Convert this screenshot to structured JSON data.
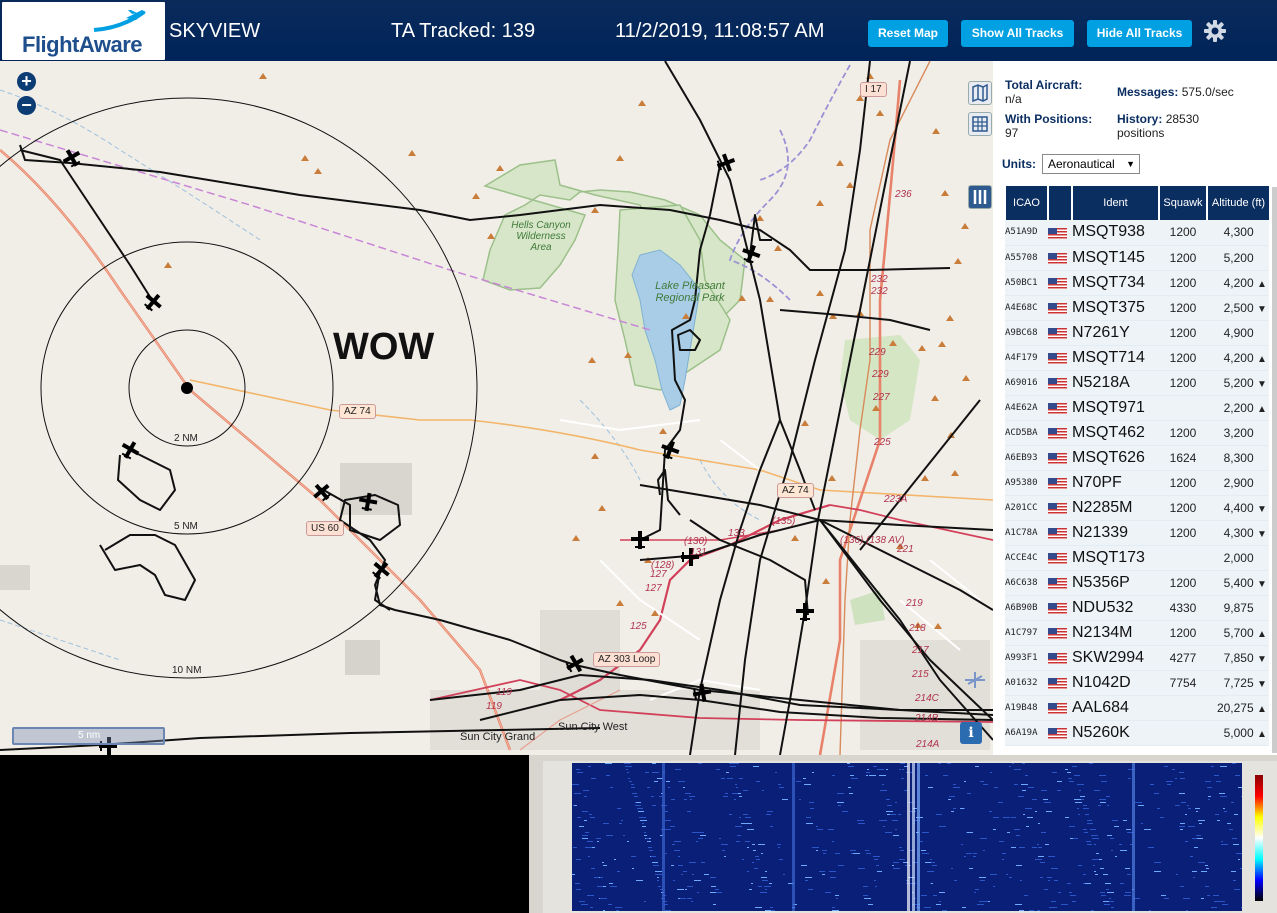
{
  "header": {
    "logo_text": "FlightAware",
    "site_name": "SKYVIEW",
    "tracked_label": "TA Tracked: 139",
    "datetime": "11/2/2019, 11:08:57 AM",
    "buttons": {
      "reset": "Reset Map",
      "show_all": "Show All Tracks",
      "hide_all": "Hide All Tracks"
    },
    "settings_icon": "gear-icon",
    "bg_color": "#002459",
    "button_color": "#00a0e2"
  },
  "map": {
    "zoom_in": "+",
    "zoom_out": "−",
    "overlay_text": "WOW",
    "range_labels": [
      "2 NM",
      "5 NM",
      "10 NM"
    ],
    "scale_label": "5 nm",
    "place_labels": [
      "Hells Canyon Wilderness Area",
      "Lake Pleasant Regional Park",
      "Sun City Grand",
      "Sun City West"
    ],
    "road_shields": [
      "AZ 74",
      "US 60",
      "AZ 303 Loop",
      "AZ 74",
      "I 17"
    ],
    "mile_markers": [
      "236",
      "232",
      "232",
      "229",
      "229",
      "227",
      "225",
      "223A",
      "221",
      "219",
      "218",
      "217",
      "215",
      "214C",
      "214B",
      "214A",
      "125",
      "127",
      "127",
      "119",
      "119",
      "(128)",
      "(130)",
      "(135)",
      "(136)",
      "(138 AV)",
      "133",
      "131"
    ],
    "info_icon": "i",
    "control_icons": [
      "map-icon",
      "grid-icon",
      "columns-icon"
    ]
  },
  "stats": {
    "total_aircraft_label": "Total Aircraft:",
    "total_aircraft_value": "n/a",
    "with_positions_label": "With Positions:",
    "with_positions_value": "97",
    "messages_label": "Messages:",
    "messages_value": "575.0/sec",
    "history_label": "History:",
    "history_value": "28530",
    "history_unit": "positions",
    "units_label": "Units:",
    "units_value": "Aeronautical"
  },
  "table": {
    "headers": [
      "ICAO",
      "",
      "Ident",
      "Squawk",
      "Altitude (ft)"
    ],
    "rows": [
      {
        "icao": "A51A9D",
        "ident": "MSQT938",
        "squawk": "1200",
        "alt": "4,300",
        "trend": ""
      },
      {
        "icao": "A55708",
        "ident": "MSQT145",
        "squawk": "1200",
        "alt": "5,200",
        "trend": ""
      },
      {
        "icao": "A50BC1",
        "ident": "MSQT734",
        "squawk": "1200",
        "alt": "4,200",
        "trend": "▲"
      },
      {
        "icao": "A4E68C",
        "ident": "MSQT375",
        "squawk": "1200",
        "alt": "2,500",
        "trend": "▼"
      },
      {
        "icao": "A9BC68",
        "ident": "N7261Y",
        "squawk": "1200",
        "alt": "4,900",
        "trend": ""
      },
      {
        "icao": "A4F179",
        "ident": "MSQT714",
        "squawk": "1200",
        "alt": "4,200",
        "trend": "▲"
      },
      {
        "icao": "A69016",
        "ident": "N5218A",
        "squawk": "1200",
        "alt": "5,200",
        "trend": "▼"
      },
      {
        "icao": "A4E62A",
        "ident": "MSQT971",
        "squawk": "",
        "alt": "2,200",
        "trend": "▲"
      },
      {
        "icao": "ACD5BA",
        "ident": "MSQT462",
        "squawk": "1200",
        "alt": "3,200",
        "trend": ""
      },
      {
        "icao": "A6EB93",
        "ident": "MSQT626",
        "squawk": "1624",
        "alt": "8,300",
        "trend": ""
      },
      {
        "icao": "A95380",
        "ident": "N70PF",
        "squawk": "1200",
        "alt": "2,900",
        "trend": ""
      },
      {
        "icao": "A201CC",
        "ident": "N2285M",
        "squawk": "1200",
        "alt": "4,400",
        "trend": "▼"
      },
      {
        "icao": "A1C78A",
        "ident": "N21339",
        "squawk": "1200",
        "alt": "4,300",
        "trend": "▼"
      },
      {
        "icao": "ACCE4C",
        "ident": "MSQT173",
        "squawk": "",
        "alt": "2,000",
        "trend": ""
      },
      {
        "icao": "A6C638",
        "ident": "N5356P",
        "squawk": "1200",
        "alt": "5,400",
        "trend": "▼"
      },
      {
        "icao": "A6B90B",
        "ident": "NDU532",
        "squawk": "4330",
        "alt": "9,875",
        "trend": ""
      },
      {
        "icao": "A1C797",
        "ident": "N2134M",
        "squawk": "1200",
        "alt": "5,700",
        "trend": "▲"
      },
      {
        "icao": "A993F1",
        "ident": "SKW2994",
        "squawk": "4277",
        "alt": "7,850",
        "trend": "▼"
      },
      {
        "icao": "A01632",
        "ident": "N1042D",
        "squawk": "7754",
        "alt": "7,725",
        "trend": "▼"
      },
      {
        "icao": "A19B48",
        "ident": "AAL684",
        "squawk": "",
        "alt": "20,275",
        "trend": "▲"
      },
      {
        "icao": "A6A19A",
        "ident": "N5260K",
        "squawk": "",
        "alt": "5,000",
        "trend": "▲"
      }
    ]
  }
}
